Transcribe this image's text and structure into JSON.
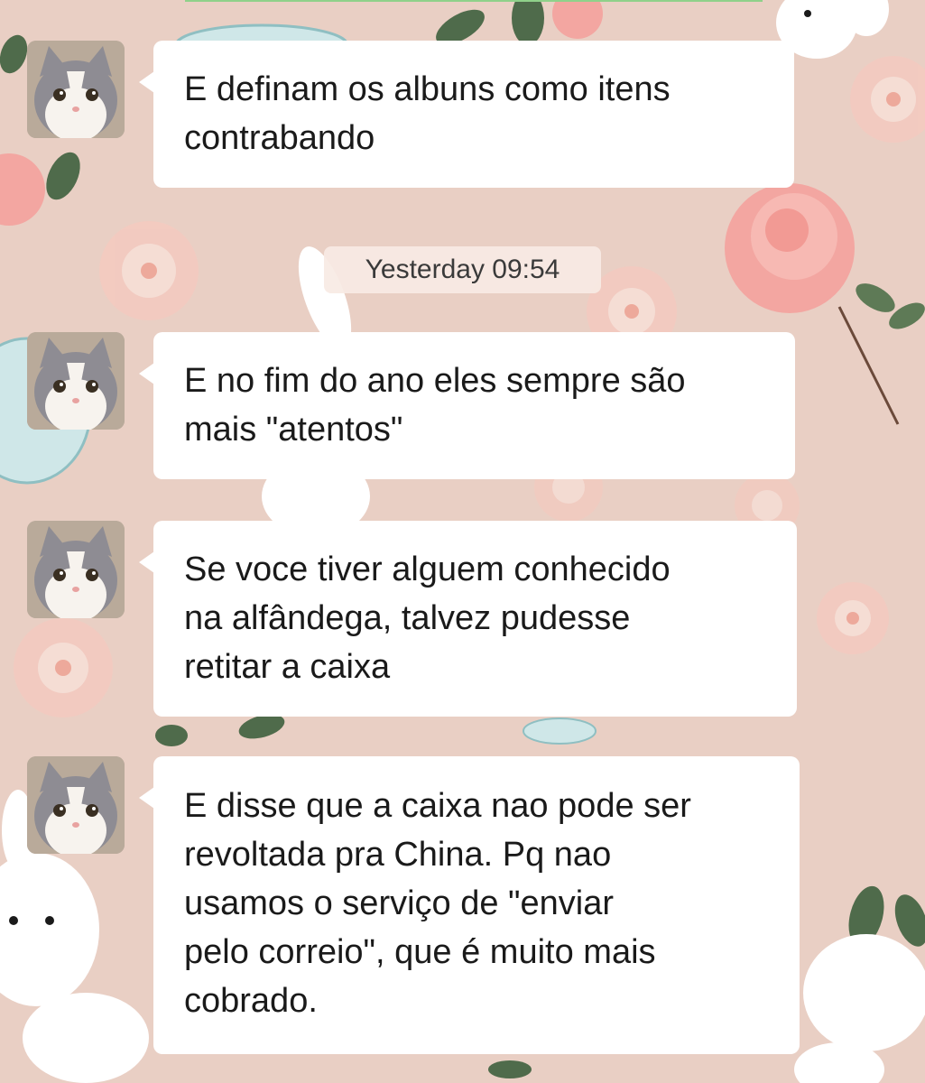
{
  "chat": {
    "messages": [
      {
        "avatar_icon": "cat-avatar-icon",
        "text": "E definam os albuns como itens\ncontrabando"
      },
      {
        "avatar_icon": "cat-avatar-icon",
        "text": "E no fim do ano eles sempre são\nmais \"atentos\""
      },
      {
        "avatar_icon": "cat-avatar-icon",
        "text": "Se voce tiver alguem conhecido\nna alfândega, talvez pudesse\nretitar a caixa"
      },
      {
        "avatar_icon": "cat-avatar-icon",
        "text": "E disse que a caixa nao pode ser\nrevoltada pra China. Pq nao\nusamos o serviço de \"enviar\npelo correio\", que é muito mais\ncobrado."
      }
    ],
    "timestamp": "Yesterday 09:54"
  },
  "theme": {
    "wallpaper": "pink floral bunny pattern",
    "background": "#e9cfc4",
    "bubble": "#ffffff",
    "text": "#1a1a1a",
    "accent_line": "#8fd18a"
  }
}
